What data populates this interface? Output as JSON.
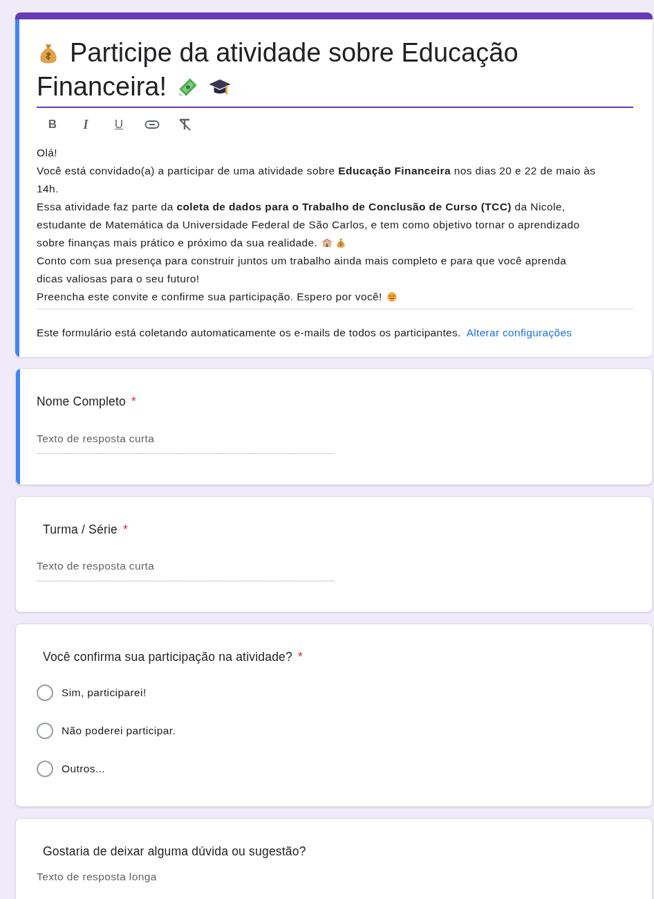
{
  "header": {
    "selected": true,
    "title_lines": [
      "Participe da atividade sobre Educação",
      "Financeira!"
    ],
    "toolbar": [
      {
        "kind": "bold",
        "label": "B"
      },
      {
        "kind": "italic",
        "label": "I"
      },
      {
        "kind": "underline",
        "label": "U"
      },
      {
        "kind": "link"
      },
      {
        "kind": "clear_format"
      }
    ],
    "description": [
      "Olá!",
      "Você está convidado(a) a participar de uma atividade sobre **Educação Financeira** nos dias 20 e 22 de maio às",
      "14h.",
      "Essa atividade faz parte da **coleta de dados para o Trabalho de Conclusão de Curso (TCC)** da Nicole,",
      "estudante de Matemática da Universidade Federal de São Carlos, e tem como objetivo tornar o aprendizado",
      "sobre finanças mais prático e próximo da sua realidade.",
      "Conto com sua presença para construir juntos um trabalho ainda mais completo e para que você aprenda",
      "dicas valiosas para o seu futuro!",
      "Preencha este convite e confirme sua participação. Espero por você!"
    ],
    "notice": "Este formulário está coletando automaticamente os e-mails de todos os participantes.",
    "notice_link": "Alterar configurações"
  },
  "questions": [
    {
      "kind": "short_text",
      "selected": true,
      "title": "Nome Completo",
      "required_mark": "*",
      "placeholder": "Texto de resposta curta"
    },
    {
      "kind": "short_text",
      "selected": false,
      "title": "Turma / Série",
      "required_mark": "*",
      "placeholder": "Texto de resposta curta"
    },
    {
      "kind": "radio",
      "selected": false,
      "title": "Você confirma sua participação na atividade?",
      "required_mark": "*",
      "options": [
        {
          "label": "Sim, participarei!",
          "selected": false
        },
        {
          "label": "Não poderei participar.",
          "selected": false
        },
        {
          "label": "Outros...",
          "selected": false
        }
      ]
    },
    {
      "kind": "long_text",
      "selected": false,
      "title": "Gostaria de deixar alguma dúvida ou sugestão?",
      "placeholder": "Texto de resposta longa"
    }
  ]
}
